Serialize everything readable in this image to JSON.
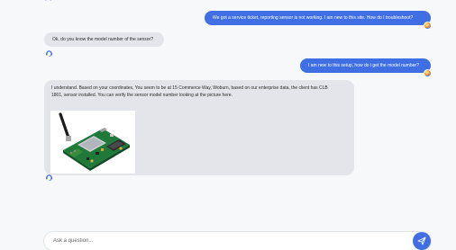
{
  "messages": [
    {
      "role": "user",
      "text": "We got a service ticket, reporting sensor is not working. I am new to this site. How do I troubleshoot?"
    },
    {
      "role": "bot",
      "text": "Ok, do you know the model number of the sensor?"
    },
    {
      "role": "user",
      "text": "I am new to this setup, how do i get the model number?"
    },
    {
      "role": "bot",
      "text": "I understand. Based on your coordinates, You seem to be at 15 Commerce Way, Woburn, based on our enterprise data, the client has CLB 1801, sensor installed. You can verify the sensor model number looking at the picture here.",
      "image": "sensor-circuit-board-photo"
    }
  ],
  "composer": {
    "placeholder": "Ask a question..."
  },
  "icons": {
    "user_avatar": "user-avatar-icon",
    "bot_avatar": "bot-headset-icon",
    "send": "send-paper-plane-icon"
  },
  "colors": {
    "user_bubble": "#3f6fe2",
    "bot_bubble": "#e3e5ea",
    "send_button": "#3f6fe2",
    "background": "#f7f8fa"
  }
}
